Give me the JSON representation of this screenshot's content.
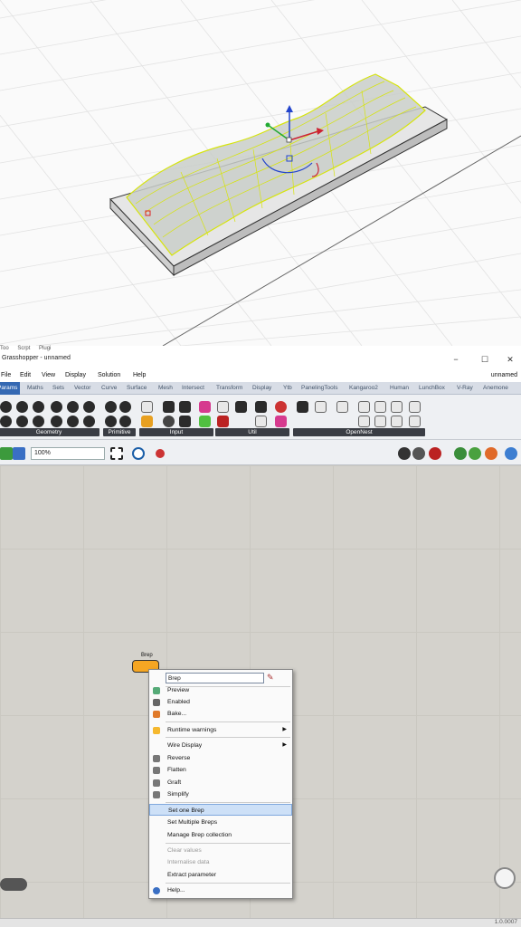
{
  "window": {
    "title_menu": [
      "Too",
      "Scrpt",
      "Plugi"
    ],
    "title": "Grasshopper - unnamed",
    "buttons": [
      "−",
      "☐",
      "✕"
    ]
  },
  "menubar": {
    "items": [
      "File",
      "Edit",
      "View",
      "Display",
      "Solution",
      "Help"
    ],
    "document": "unnamed"
  },
  "tabs": [
    "Params",
    "Maths",
    "Sets",
    "Vector",
    "Curve",
    "Surface",
    "Mesh",
    "Intersect",
    "Transform",
    "Display",
    "Ytb",
    "PanelingTools",
    "Kangaroo2",
    "Human",
    "LunchBox",
    "V-Ray",
    "Anemone"
  ],
  "active_tab": "Params",
  "ribbon_groups": [
    "Geometry",
    "Primitive",
    "Input",
    "Util",
    "OpenNest"
  ],
  "toolbar": {
    "zoom": "100%"
  },
  "component": {
    "label": "Brep"
  },
  "context_menu": {
    "name_value": "Brep",
    "items": [
      {
        "label": "Preview",
        "icon": "preview-icon"
      },
      {
        "label": "Enabled",
        "icon": "enabled-icon"
      },
      {
        "label": "Bake...",
        "icon": "bake-icon"
      },
      {
        "label": "Runtime warnings",
        "icon": "warning-icon",
        "submenu": true
      },
      {
        "label": "Wire Display",
        "submenu": true
      },
      {
        "label": "Reverse",
        "icon": "reverse-icon"
      },
      {
        "label": "Flatten",
        "icon": "flatten-icon"
      },
      {
        "label": "Graft",
        "icon": "graft-icon"
      },
      {
        "label": "Simplify",
        "icon": "simplify-icon"
      },
      {
        "label": "Set one Brep",
        "highlighted": true
      },
      {
        "label": "Set Multiple Breps"
      },
      {
        "label": "Manage Brep collection"
      },
      {
        "label": "Clear values",
        "disabled": true
      },
      {
        "label": "Internalise data",
        "disabled": true
      },
      {
        "label": "Extract parameter"
      },
      {
        "label": "Help...",
        "icon": "help-icon"
      }
    ]
  },
  "status": {
    "version": "1.0.0007"
  }
}
